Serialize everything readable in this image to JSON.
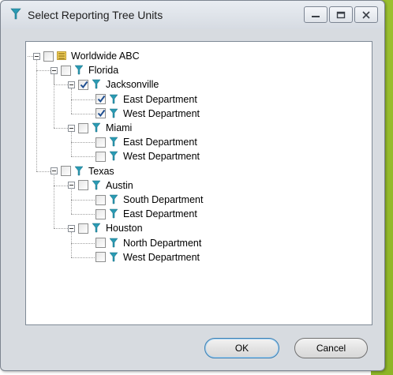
{
  "window": {
    "title": "Select Reporting Tree Units",
    "title_icon": "filter-funnel-icon",
    "controls": [
      "minimize",
      "maximize",
      "close"
    ]
  },
  "tree": {
    "nodes": [
      {
        "label": "Worldwide ABC",
        "level": 0,
        "checked": false,
        "expandable": true,
        "icon": "list-folder-icon"
      },
      {
        "label": "Florida",
        "level": 1,
        "checked": false,
        "expandable": true,
        "icon": "filter-funnel-icon"
      },
      {
        "label": "Jacksonville",
        "level": 2,
        "checked": true,
        "expandable": true,
        "icon": "filter-funnel-icon"
      },
      {
        "label": "East Department",
        "level": 3,
        "checked": true,
        "expandable": false,
        "icon": "filter-funnel-icon"
      },
      {
        "label": "West Department",
        "level": 3,
        "checked": true,
        "expandable": false,
        "icon": "filter-funnel-icon"
      },
      {
        "label": "Miami",
        "level": 2,
        "checked": false,
        "expandable": true,
        "icon": "filter-funnel-icon"
      },
      {
        "label": "East Department",
        "level": 3,
        "checked": false,
        "expandable": false,
        "icon": "filter-funnel-icon"
      },
      {
        "label": "West Department",
        "level": 3,
        "checked": false,
        "expandable": false,
        "icon": "filter-funnel-icon"
      },
      {
        "label": "Texas",
        "level": 1,
        "checked": false,
        "expandable": true,
        "icon": "filter-funnel-icon"
      },
      {
        "label": "Austin",
        "level": 2,
        "checked": false,
        "expandable": true,
        "icon": "filter-funnel-icon"
      },
      {
        "label": "South Department",
        "level": 3,
        "checked": false,
        "expandable": false,
        "icon": "filter-funnel-icon"
      },
      {
        "label": "East Department",
        "level": 3,
        "checked": false,
        "expandable": false,
        "icon": "filter-funnel-icon"
      },
      {
        "label": "Houston",
        "level": 2,
        "checked": false,
        "expandable": true,
        "icon": "filter-funnel-icon"
      },
      {
        "label": "North Department",
        "level": 3,
        "checked": false,
        "expandable": false,
        "icon": "filter-funnel-icon"
      },
      {
        "label": "West Department",
        "level": 3,
        "checked": false,
        "expandable": false,
        "icon": "filter-funnel-icon"
      }
    ]
  },
  "buttons": {
    "ok_label": "OK",
    "cancel_label": "Cancel"
  },
  "colors": {
    "accent_green": "#a9cc3a",
    "funnel_teal": "#2a9ab3",
    "check_blue": "#1f4f91"
  }
}
